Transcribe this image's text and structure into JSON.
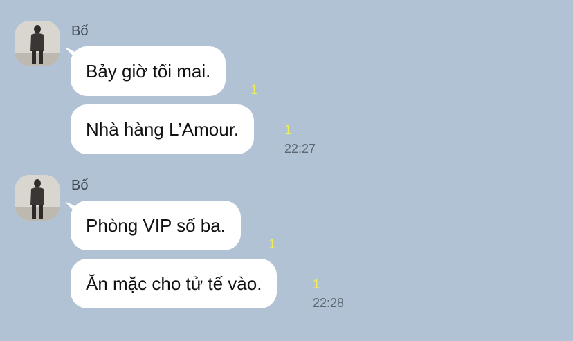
{
  "groups": [
    {
      "sender": "Bố",
      "messages": [
        {
          "text": "Bảy giờ tối mai.",
          "read_count": "1",
          "time": ""
        },
        {
          "text": "Nhà hàng L’Amour.",
          "read_count": "1",
          "time": "22:27"
        }
      ]
    },
    {
      "sender": "Bố",
      "messages": [
        {
          "text": "Phòng VIP số ba.",
          "read_count": "1",
          "time": ""
        },
        {
          "text": "Ăn mặc cho tử tế vào.",
          "read_count": "1",
          "time": "22:28"
        }
      ]
    }
  ],
  "colors": {
    "background": "#b1c2d4",
    "bubble": "#ffffff",
    "read_indicator": "#f1ee59"
  }
}
